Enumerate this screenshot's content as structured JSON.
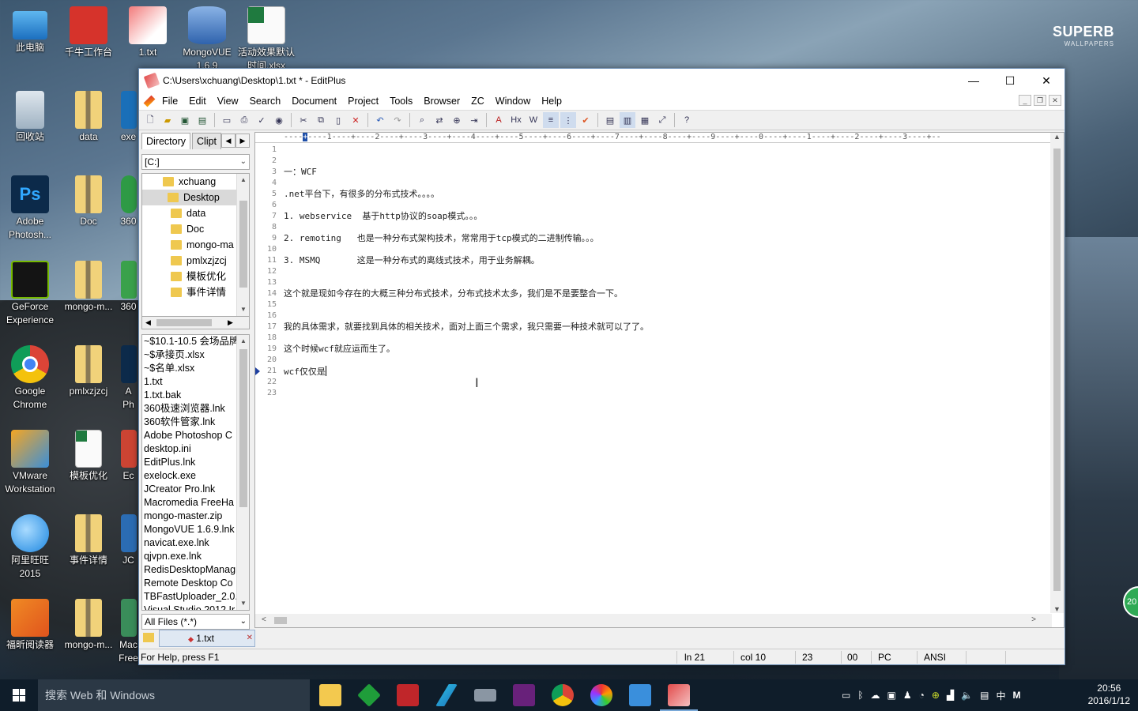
{
  "wallpaper": {
    "brand_line1": "SUPERB",
    "brand_line2": "WALLPAPERS"
  },
  "desktop_icons": [
    {
      "label": "此电脑"
    },
    {
      "label": "千牛工作台"
    },
    {
      "label": "1.txt"
    },
    {
      "label": "MongoVUE 1.6.9"
    },
    {
      "label": "活动效果默认时间.xlsx"
    },
    {
      "label": "回收站"
    },
    {
      "label": "data"
    },
    {
      "label": "exe"
    },
    {
      "label": "Adobe Photosh..."
    },
    {
      "label": "Doc"
    },
    {
      "label": "360"
    },
    {
      "label": "GeForce Experience"
    },
    {
      "label": "mongo-m..."
    },
    {
      "label": "360"
    },
    {
      "label": "Google Chrome"
    },
    {
      "label": "pmlxzjzcj"
    },
    {
      "label": "A Ph"
    },
    {
      "label": "VMware Workstation"
    },
    {
      "label": "模板优化"
    },
    {
      "label": "Ec"
    },
    {
      "label": "阿里旺旺 2015"
    },
    {
      "label": "事件详情"
    },
    {
      "label": "JC"
    },
    {
      "label": "福昕阅读器"
    },
    {
      "label": "mongo-m..."
    },
    {
      "label": "Mac Free"
    }
  ],
  "window": {
    "title": "C:\\Users\\xchuang\\Desktop\\1.txt * - EditPlus",
    "controls": {
      "minimize": "—",
      "maximize": "☐",
      "close": "✕"
    }
  },
  "menu": [
    "File",
    "Edit",
    "View",
    "Search",
    "Document",
    "Project",
    "Tools",
    "Browser",
    "ZC",
    "Window",
    "Help"
  ],
  "mdi_controls": [
    "_",
    "❐",
    "✕"
  ],
  "sidebar": {
    "tabs": [
      "Directory",
      "Clipt"
    ],
    "drive": "[C:]",
    "tree": [
      {
        "name": "xchuang",
        "selected": false
      },
      {
        "name": "Desktop",
        "selected": true
      },
      {
        "name": "data",
        "selected": false
      },
      {
        "name": "Doc",
        "selected": false
      },
      {
        "name": "mongo-ma",
        "selected": false
      },
      {
        "name": "pmlxzjzcj",
        "selected": false
      },
      {
        "name": "模板优化",
        "selected": false
      },
      {
        "name": "事件详情",
        "selected": false
      }
    ],
    "files": [
      "~$10.1-10.5 会场品牌",
      "~$承接页.xlsx",
      "~$名单.xlsx",
      "1.txt",
      "1.txt.bak",
      "360极速浏览器.lnk",
      "360软件管家.lnk",
      "Adobe Photoshop C",
      "desktop.ini",
      "EditPlus.lnk",
      "exelock.exe",
      "JCreator Pro.lnk",
      "Macromedia FreeHa",
      "mongo-master.zip",
      "MongoVUE 1.6.9.lnk",
      "navicat.exe.lnk",
      "qjvpn.exe.lnk",
      "RedisDesktopManag",
      "Remote Desktop Co",
      "TBFastUploader_2.0.",
      "Visual Studio 2012 Ir"
    ],
    "filter": "All Files (*.*)"
  },
  "editor": {
    "ruler": "----+----1----+----2----+----3----+----4----+----5----+----6----+----7----+----8----+----9----+----0----+----1----+----2----+----3----+--",
    "lines": [
      "",
      "",
      "一：WCF",
      "",
      ".net平台下，有很多的分布式技术。。。。",
      "",
      "1. webservice  基于http协议的soap模式。。。",
      "",
      "2. remoting   也是一种分布式架构技术，常常用于tcp模式的二进制传输。。。",
      "",
      "3. MSMQ       这是一种分布式的离线式技术，用于业务解耦。",
      "",
      "",
      "这个就是现如今存在的大概三种分布式技术，分布式技术太多，我们是不是要整合一下。",
      "",
      "",
      "我的具体需求，就要找到具体的相关技术，面对上面三个需求，我只需要一种技术就可以了了。",
      "",
      "这个时候wcf就应运而生了。",
      "",
      "wcf仅仅是",
      "",
      ""
    ],
    "current_line": 21
  },
  "doc_tab": {
    "label": "1.txt"
  },
  "status": {
    "help": "For Help, press F1",
    "line": "ln 21",
    "col": "col 10",
    "total": "23",
    "num": "00",
    "mode": "PC",
    "encoding": "ANSI"
  },
  "taskbar": {
    "search_placeholder": "搜索 Web 和 Windows",
    "time": "20:56",
    "date": "2016/1/12",
    "ime": "中",
    "ime2": "M"
  },
  "badge": "20"
}
